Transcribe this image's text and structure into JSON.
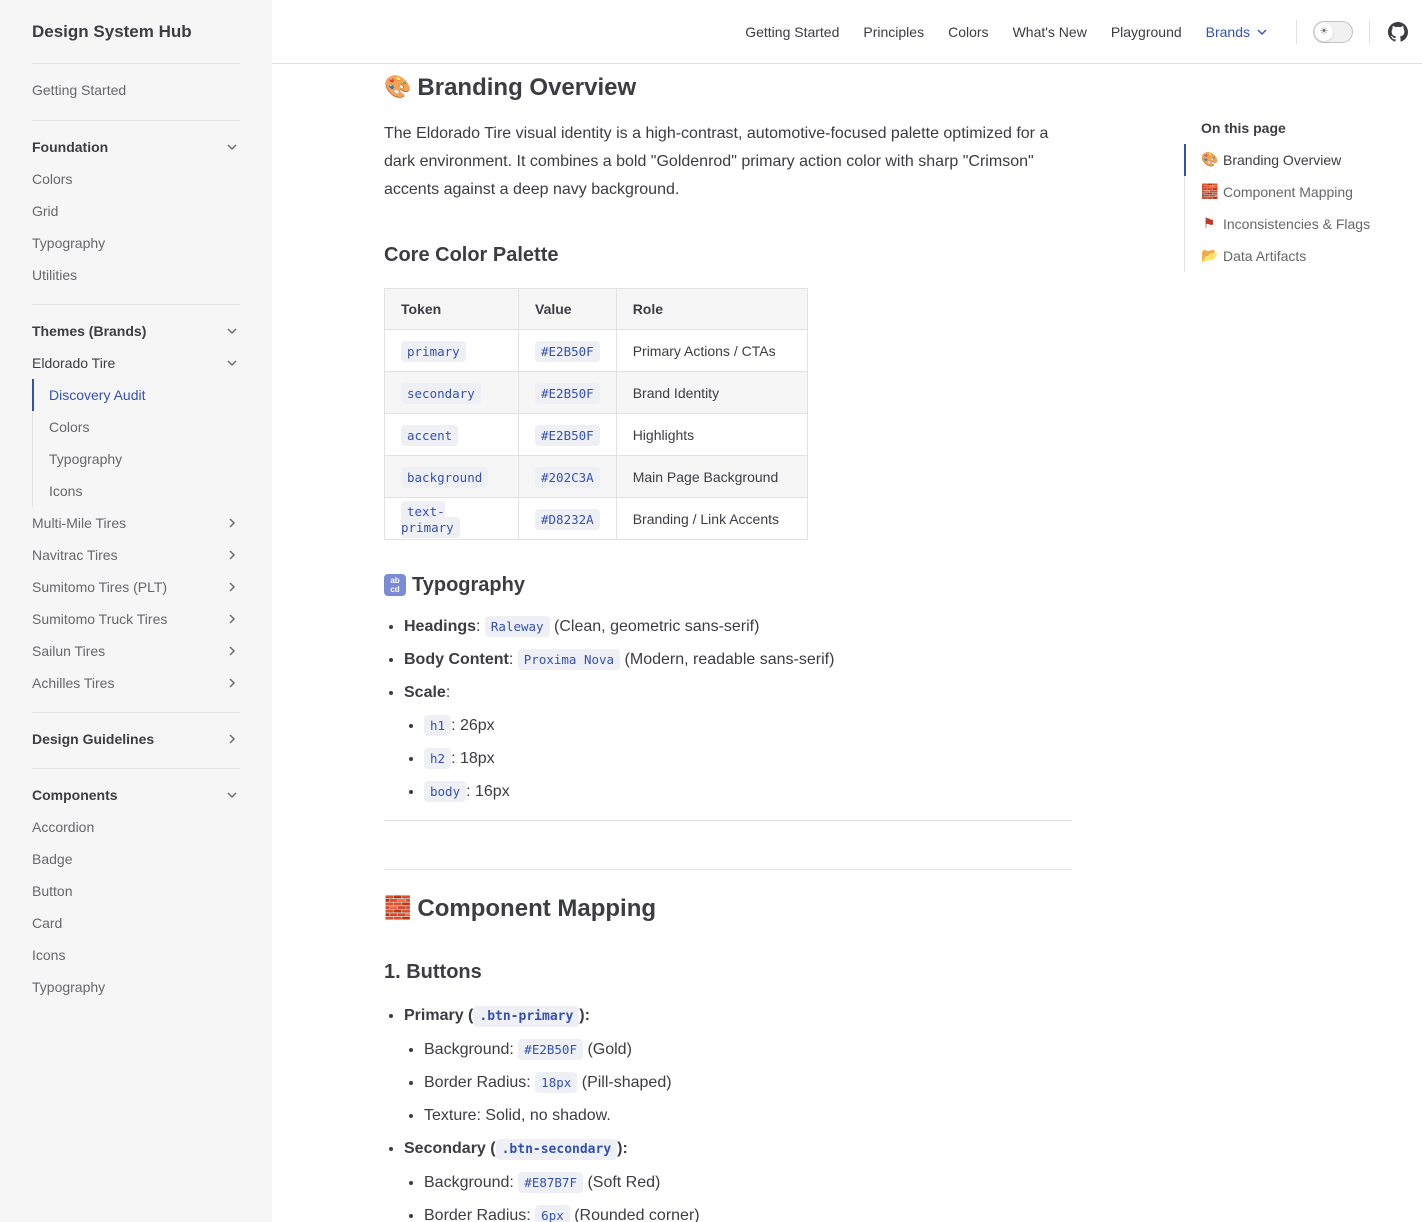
{
  "sidebar": {
    "brand": "Design System Hub",
    "getting_started": "Getting Started",
    "foundation": {
      "label": "Foundation",
      "items": [
        "Colors",
        "Grid",
        "Typography",
        "Utilities"
      ]
    },
    "themes": {
      "label": "Themes (Brands)",
      "eldorado": {
        "label": "Eldorado Tire",
        "items": [
          "Discovery Audit",
          "Colors",
          "Typography",
          "Icons"
        ]
      },
      "other_brands": [
        "Multi-Mile Tires",
        "Navitrac Tires",
        "Sumitomo Tires (PLT)",
        "Sumitomo Truck Tires",
        "Sailun Tires",
        "Achilles Tires"
      ]
    },
    "design_guidelines": "Design Guidelines",
    "components": {
      "label": "Components",
      "items": [
        "Accordion",
        "Badge",
        "Button",
        "Card",
        "Icons",
        "Typography"
      ]
    }
  },
  "nav": {
    "links": [
      "Getting Started",
      "Principles",
      "Colors",
      "What's New",
      "Playground"
    ],
    "brands": "Brands"
  },
  "content": {
    "branding_title": "Branding Overview",
    "intro": "The Eldorado Tire visual identity is a high-contrast, automotive-focused palette optimized for a dark environment. It combines a bold \"Goldenrod\" primary action color with sharp \"Crimson\" accents against a deep navy background.",
    "palette_title": "Core Color Palette",
    "table": {
      "headers": [
        "Token",
        "Value",
        "Role"
      ],
      "rows": [
        {
          "token": "primary",
          "value": "#E2B50F",
          "role": "Primary Actions / CTAs"
        },
        {
          "token": "secondary",
          "value": "#E2B50F",
          "role": "Brand Identity"
        },
        {
          "token": "accent",
          "value": "#E2B50F",
          "role": "Highlights"
        },
        {
          "token": "background",
          "value": "#202C3A",
          "role": "Main Page Background"
        },
        {
          "token": "text-primary",
          "value": "#D8232A",
          "role": "Branding / Link Accents"
        }
      ]
    },
    "typography_title": "Typography",
    "typography": {
      "headings_label": "Headings",
      "headings_font": "Raleway",
      "headings_desc": "(Clean, geometric sans-serif)",
      "body_label": "Body Content",
      "body_font": "Proxima Nova",
      "body_desc": "(Modern, readable sans-serif)",
      "scale_label": "Scale",
      "scale": [
        {
          "tag": "h1",
          "value": ": 26px"
        },
        {
          "tag": "h2",
          "value": ": 18px"
        },
        {
          "tag": "body",
          "value": ": 16px"
        }
      ]
    },
    "component_title": "Component Mapping",
    "buttons_title": "1. Buttons",
    "primary_btn": {
      "label": "Primary (",
      "class": ".btn-primary",
      "close": "):",
      "bg_label": "Background:",
      "bg_value": "#E2B50F",
      "bg_desc": "(Gold)",
      "radius_label": "Border Radius:",
      "radius_value": "18px",
      "radius_desc": "(Pill-shaped)",
      "texture": "Texture: Solid, no shadow."
    },
    "secondary_btn": {
      "label": "Secondary (",
      "class": ".btn-secondary",
      "close": "):",
      "bg_label": "Background:",
      "bg_value": "#E87B7F",
      "bg_desc": "(Soft Red)",
      "radius_label": "Border Radius:",
      "radius_value": "6px",
      "radius_desc": "(Rounded corner)"
    }
  },
  "toc": {
    "title": "On this page",
    "links": [
      "Branding Overview",
      "Component Mapping",
      "Inconsistencies & Flags",
      "Data Artifacts"
    ]
  },
  "colors": {
    "accent": "#3451b2",
    "sidebar_bg": "#f6f6f7",
    "text": "#3c3c43"
  },
  "icons": [
    "palette-emoji",
    "bricks-emoji",
    "abcd-emoji",
    "flag-emoji",
    "folder-emoji",
    "github-icon",
    "sun-icon",
    "chevron-down-icon",
    "chevron-right-icon"
  ]
}
